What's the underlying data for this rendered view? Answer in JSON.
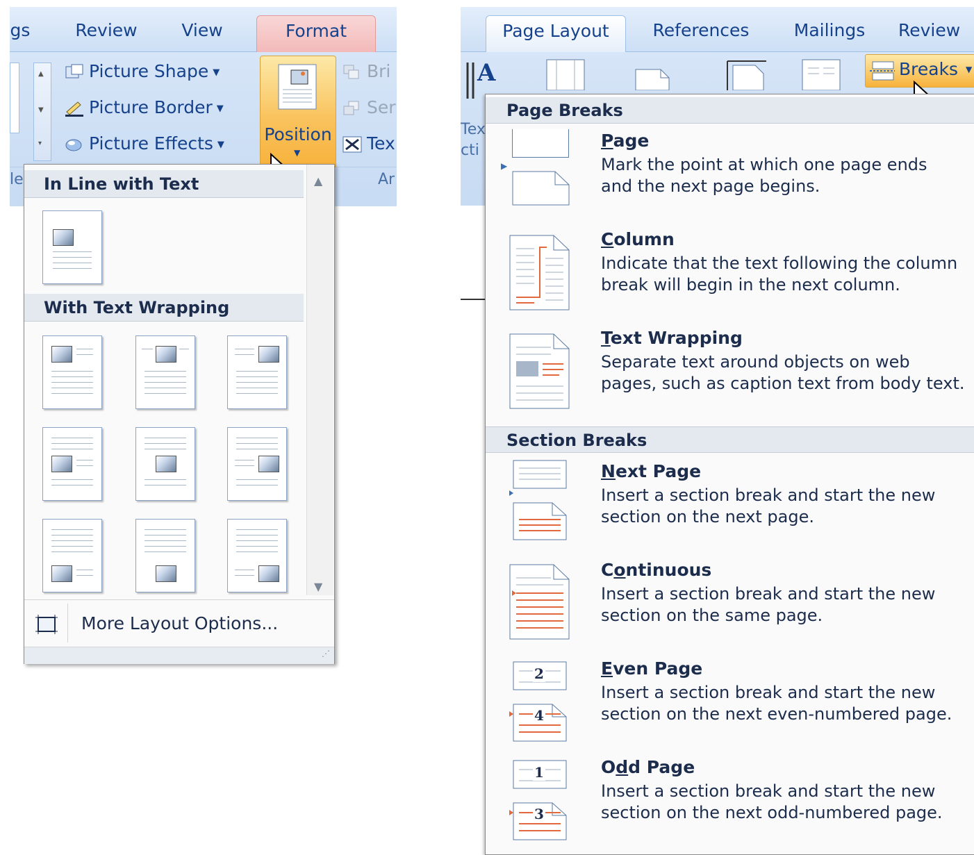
{
  "left": {
    "tabs": [
      "gs",
      "Review",
      "View",
      "Format"
    ],
    "ribbon_items": [
      {
        "label": "Picture Shape",
        "icon": "picture-shape-icon"
      },
      {
        "label": "Picture Border",
        "icon": "picture-border-icon"
      },
      {
        "label": "Picture Effects",
        "icon": "picture-effects-icon"
      }
    ],
    "position_label": "Position",
    "arrange_items": [
      "Bri",
      "Ser",
      "Tex"
    ],
    "partial_group_label": "Ar",
    "partial_left_label": "le",
    "menu": {
      "heading_inline": "In Line with Text",
      "heading_wrap": "With Text Wrapping",
      "more_options": "More Layout Options..."
    }
  },
  "right": {
    "tabs": [
      "Page Layout",
      "References",
      "Mailings",
      "Review"
    ],
    "breaks_label": "Breaks",
    "partial_left_text": [
      "Tex",
      "cti"
    ],
    "menu": {
      "page_breaks_heading": "Page Breaks",
      "section_breaks_heading": "Section Breaks",
      "items": [
        {
          "title_pre": "",
          "title_ul": "P",
          "title_post": "age",
          "desc1": "Mark the point at which one page ends",
          "desc2": "and the next page begins."
        },
        {
          "title_pre": "",
          "title_ul": "C",
          "title_post": "olumn",
          "desc1": "Indicate that the text following the column",
          "desc2": "break will begin in the next column."
        },
        {
          "title_pre": "",
          "title_ul": "T",
          "title_post": "ext Wrapping",
          "desc1": "Separate text around objects on web",
          "desc2": "pages, such as caption text from body text."
        },
        {
          "title_pre": "",
          "title_ul": "N",
          "title_post": "ext Page",
          "desc1": "Insert a section break and start the new",
          "desc2": "section on the next page."
        },
        {
          "title_pre": "C",
          "title_ul": "o",
          "title_post": "ntinuous",
          "desc1": "Insert a section break and start the new",
          "desc2": "section on the same page."
        },
        {
          "title_pre": "",
          "title_ul": "E",
          "title_post": "ven Page",
          "desc1": "Insert a section break and start the new",
          "desc2": "section on the next even-numbered page."
        },
        {
          "title_pre": "O",
          "title_ul": "d",
          "title_post": "d Page",
          "desc1": "Insert a section break and start the new",
          "desc2": "section on the next odd-numbered page."
        }
      ],
      "even_icon_numbers": [
        "2",
        "4"
      ],
      "odd_icon_numbers": [
        "1",
        "3"
      ]
    }
  },
  "colors": {
    "accent": "#15428b",
    "highlight": "#f9c35e",
    "break_red": "#e06a3b"
  }
}
